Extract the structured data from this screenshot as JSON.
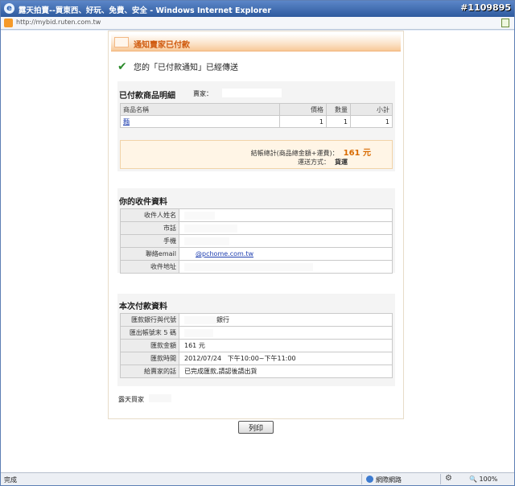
{
  "window": {
    "title": "露天拍賣--買東西、好玩、免費、安全 - Windows Internet Explorer",
    "watermark": "#1109895",
    "address": "http://mybid.ruten.com.tw"
  },
  "header": {
    "title": "通知賣家已付款"
  },
  "confirmation": {
    "message": "您的「已付款通知」已經傳送"
  },
  "product_section": {
    "title": "已付款商品明細",
    "seller_label": "賣家：",
    "columns": [
      "商品名稱",
      "價格",
      "數量",
      "小計"
    ],
    "rows": [
      {
        "name": "麵",
        "price": "1",
        "qty": "1",
        "subtotal": "1"
      }
    ],
    "total_label": "結帳總計(商品總金額+運費)：",
    "total_amount": "161 元",
    "shipping_label": "運送方式：",
    "shipping_value": "貨運"
  },
  "recipient_section": {
    "title": "你的收件資料",
    "fields": [
      {
        "label": "收件人姓名",
        "value": ""
      },
      {
        "label": "市話",
        "value": ""
      },
      {
        "label": "手機",
        "value": ""
      },
      {
        "label": "聯絡email",
        "value": "@pchome.com.tw"
      },
      {
        "label": "收件地址",
        "value": ""
      }
    ]
  },
  "payment_section": {
    "title": "本次付款資料",
    "fields": [
      {
        "label": "匯款銀行與代號",
        "value": "銀行"
      },
      {
        "label": "匯出帳號末 5 碼",
        "value": ""
      },
      {
        "label": "匯款金額",
        "value": "161 元"
      },
      {
        "label": "匯款時間",
        "value": "2012/07/24   下午10:00~下午11:00"
      },
      {
        "label": "給賣家的話",
        "value": "已完成匯款,請認後請出貨"
      }
    ]
  },
  "footer": {
    "name_label": "露天買家"
  },
  "print_button": "列印",
  "statusbar": {
    "left": "完成",
    "zone": "網際網路",
    "zoom": "100%"
  }
}
